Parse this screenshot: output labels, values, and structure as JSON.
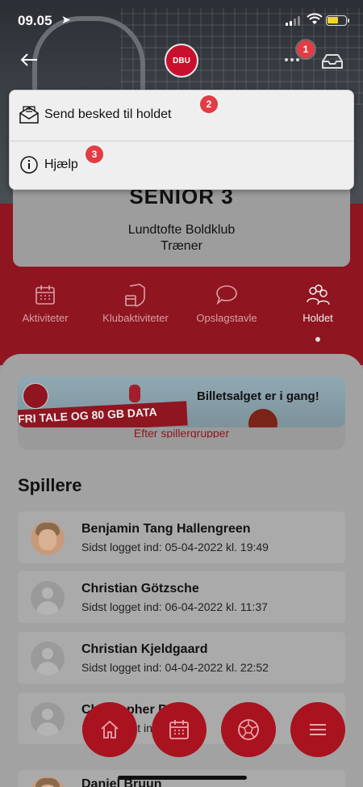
{
  "status_bar": {
    "time": "09.05"
  },
  "header": {
    "logo_text": "DBU",
    "badge_1": "1"
  },
  "menu": {
    "items": [
      {
        "label": "Send besked til holdet",
        "badge": "2",
        "icon": "envelope-open-icon"
      },
      {
        "label": "Hjælp",
        "badge": "3",
        "icon": "info-circle-icon"
      }
    ]
  },
  "team": {
    "title": "SENIOR 3",
    "club": "Lundtofte Boldklub",
    "role": "Træner"
  },
  "tabs": [
    {
      "label": "Aktiviteter",
      "icon": "calendar-icon"
    },
    {
      "label": "Klubaktiviteter",
      "icon": "club-calendar-icon"
    },
    {
      "label": "Opslagstavle",
      "icon": "chat-bubble-icon"
    },
    {
      "label": "Holdet",
      "icon": "people-icon",
      "active": true
    }
  ],
  "banner": {
    "headline": "Billetsalget er i gang!",
    "promo": "FRI TALE OG 80 GB DATA",
    "link": "Efter spillergrupper"
  },
  "players_section": {
    "title": "Spillere",
    "players": [
      {
        "name": "Benjamin Tang Hallengreen",
        "login": "Sidst logget ind: 05-04-2022 kl. 19:49",
        "photo": true
      },
      {
        "name": "Christian Götzsche",
        "login": "Sidst logget ind: 06-04-2022 kl. 11:37",
        "photo": false
      },
      {
        "name": "Christian Kjeldgaard",
        "login": "Sidst logget ind: 04-04-2022 kl. 22:52",
        "photo": false
      },
      {
        "name": "Christopher P",
        "login": "Sidst logget ind:",
        "photo": false
      },
      {
        "name": "Daniel Bruun",
        "login": "",
        "photo": true
      }
    ]
  },
  "bottom_nav": [
    {
      "icon": "home-icon"
    },
    {
      "icon": "calendar-icon"
    },
    {
      "icon": "football-icon"
    },
    {
      "icon": "hamburger-menu-icon"
    }
  ],
  "colors": {
    "brand_red": "#c8102e",
    "badge_red": "#e23c44",
    "overlay_gray": "#a2a2a2"
  }
}
